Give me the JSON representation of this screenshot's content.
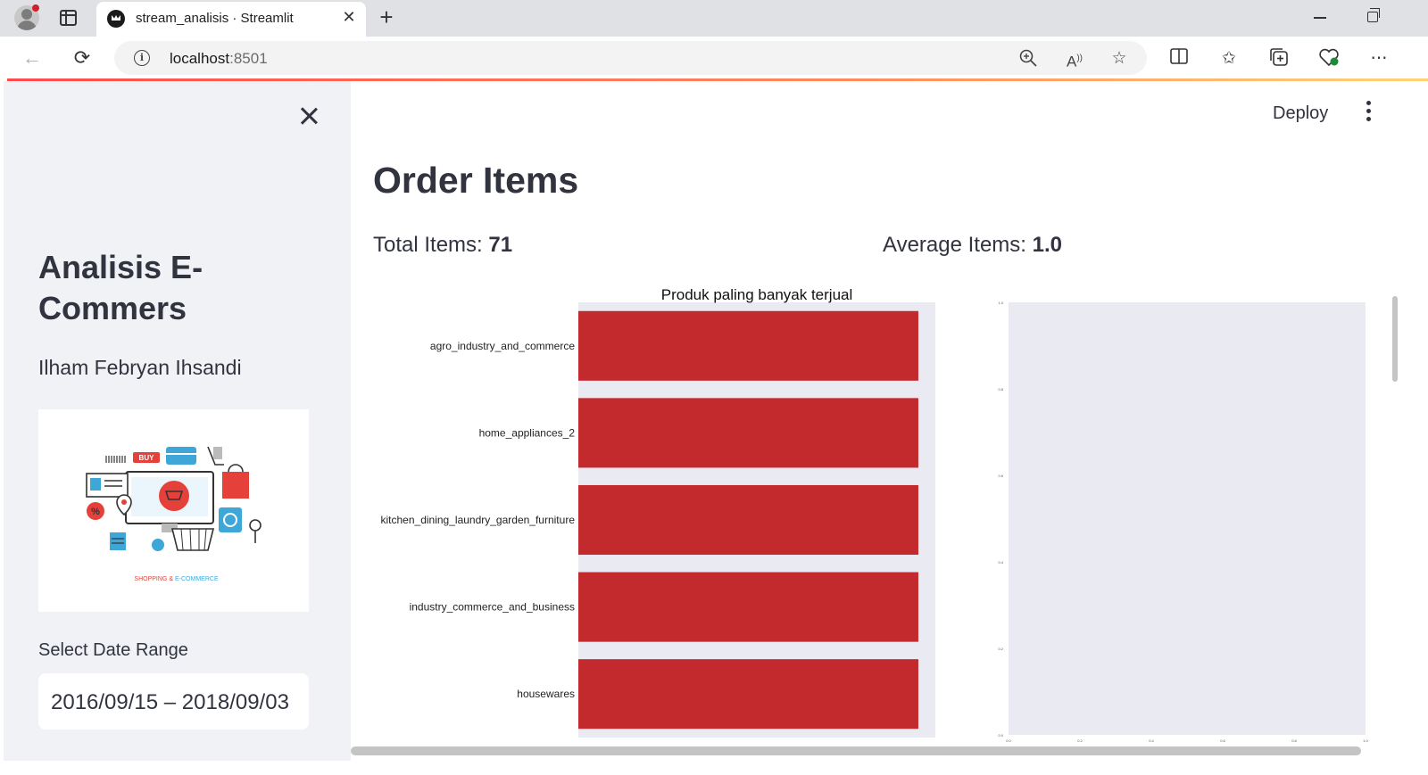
{
  "browser": {
    "tab_title": "stream_analisis · Streamlit",
    "url_host": "localhost",
    "url_port": ":8501"
  },
  "sidebar": {
    "title": "Analisis E-Commers",
    "author": "Ilham Febryan Ihsandi",
    "image_caption_left": "SHOPPING &",
    "image_caption_right": "E-COMMERCE",
    "date_label": "Select Date Range",
    "date_value": "2016/09/15 – 2018/09/03"
  },
  "header": {
    "deploy_label": "Deploy"
  },
  "main": {
    "title": "Order Items",
    "total_label": "Total Items:",
    "total_value": "71",
    "avg_label": "Average Items:",
    "avg_value": "1.0"
  },
  "colors": {
    "bar": "#c32a2e",
    "plot_bg": "#eaeaf2",
    "accent": "#ff4b4b"
  },
  "chart_data": [
    {
      "type": "bar",
      "orientation": "horizontal",
      "title": "Produk paling banyak terjual",
      "categories": [
        "agro_industry_and_commerce",
        "home_appliances_2",
        "kitchen_dining_laundry_garden_furniture",
        "industry_commerce_and_business",
        "housewares"
      ],
      "values": [
        1.0,
        1.0,
        1.0,
        1.0,
        1.0
      ],
      "xlim": [
        0.0,
        1.05
      ],
      "xticks": [
        "0.0",
        "0.2",
        "0.4",
        "0.6",
        "0.8",
        "1.0"
      ],
      "grid": false
    },
    {
      "type": "bar",
      "orientation": "horizontal",
      "title": "",
      "categories": [],
      "values": [],
      "xticks": [
        "0.0",
        "0.2",
        "0.4",
        "0.6",
        "0.8",
        "1.0"
      ],
      "yticks": [
        "0.0",
        "0.2",
        "0.4",
        "0.6",
        "0.8",
        "1.0"
      ],
      "grid": false
    }
  ]
}
